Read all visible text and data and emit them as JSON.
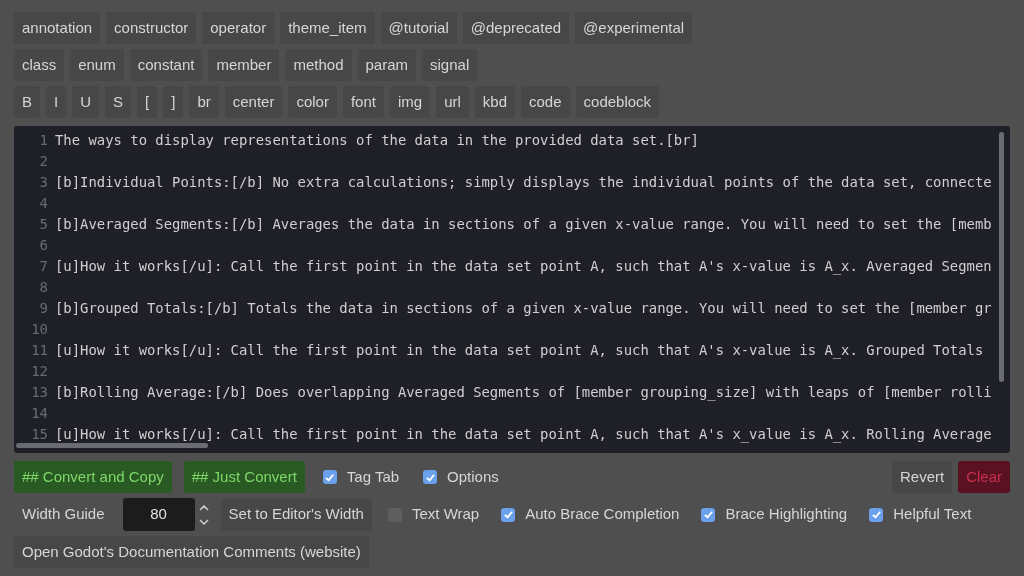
{
  "tag_rows": [
    [
      "annotation",
      "constructor",
      "operator",
      "theme_item",
      "@tutorial",
      "@deprecated",
      "@experimental"
    ],
    [
      "class",
      "enum",
      "constant",
      "member",
      "method",
      "param",
      "signal"
    ],
    [
      "B",
      "I",
      "U",
      "S",
      "[",
      "]",
      "br",
      "center",
      "color",
      "font",
      "img",
      "url",
      "kbd",
      "code",
      "codeblock"
    ]
  ],
  "editor": {
    "lines": [
      {
        "number": "1",
        "text": "The ways to display representations of the data in the provided data set.[br]"
      },
      {
        "number": "2"
      },
      {
        "number": "3",
        "text": "[b]Individual Points:[/b] No extra calculations; simply displays the individual points of the data set, connecte"
      },
      {
        "number": "4"
      },
      {
        "number": "5",
        "text": "[b]Averaged Segments:[/b] Averages the data in sections of a given x-value range. You will need to set the [memb"
      },
      {
        "number": "6"
      },
      {
        "number": "7",
        "text": "[u]How it works[/u]: Call the first point in the data set point A, such that A's x-value is A_x. Averaged Segmen"
      },
      {
        "number": "8"
      },
      {
        "number": "9",
        "text": "[b]Grouped Totals:[/b] Totals the data in sections of a given x-value range. You will need to set the [member gr"
      },
      {
        "number": "10"
      },
      {
        "number": "11",
        "text": "[u]How it works[/u]: Call the first point in the data set point A, such that A's x-value is A_x. Grouped Totals"
      },
      {
        "number": "12"
      },
      {
        "number": "13",
        "text": "[b]Rolling Average:[/b] Does overlapping Averaged Segments of [member grouping_size] with leaps of [member rolli"
      },
      {
        "number": "14"
      },
      {
        "number": "15",
        "text": "[u]How it works[/u]: Call the first point in the data set point A, such that A's x_value is A_x. Rolling Average"
      }
    ]
  },
  "action_row": {
    "left": [
      {
        "kind": "primary",
        "label": "## Convert and Copy"
      },
      {
        "kind": "primary",
        "label": "## Just Convert"
      },
      {
        "kind": "checkbox",
        "label": "Tag Tab",
        "checked": true
      },
      {
        "kind": "checkbox",
        "label": "Options",
        "checked": true
      }
    ],
    "right": [
      {
        "kind": "plain",
        "label": "Revert"
      },
      {
        "kind": "danger",
        "label": "Clear"
      }
    ]
  },
  "options_row": [
    {
      "kind": "label",
      "label": "Width Guide"
    },
    {
      "kind": "spinbox",
      "value": "80"
    },
    {
      "kind": "plain",
      "label": "Set to Editor's Width"
    },
    {
      "kind": "checkbox",
      "label": "Text Wrap",
      "checked": false
    },
    {
      "kind": "checkbox",
      "label": "Auto Brace Completion",
      "checked": true
    },
    {
      "kind": "checkbox",
      "label": "Brace Highlighting",
      "checked": true
    },
    {
      "kind": "checkbox",
      "label": "Helpful Text",
      "checked": true
    }
  ],
  "link_row": [
    {
      "kind": "plain",
      "label": "Open Godot's Documentation Comments (website)"
    }
  ]
}
